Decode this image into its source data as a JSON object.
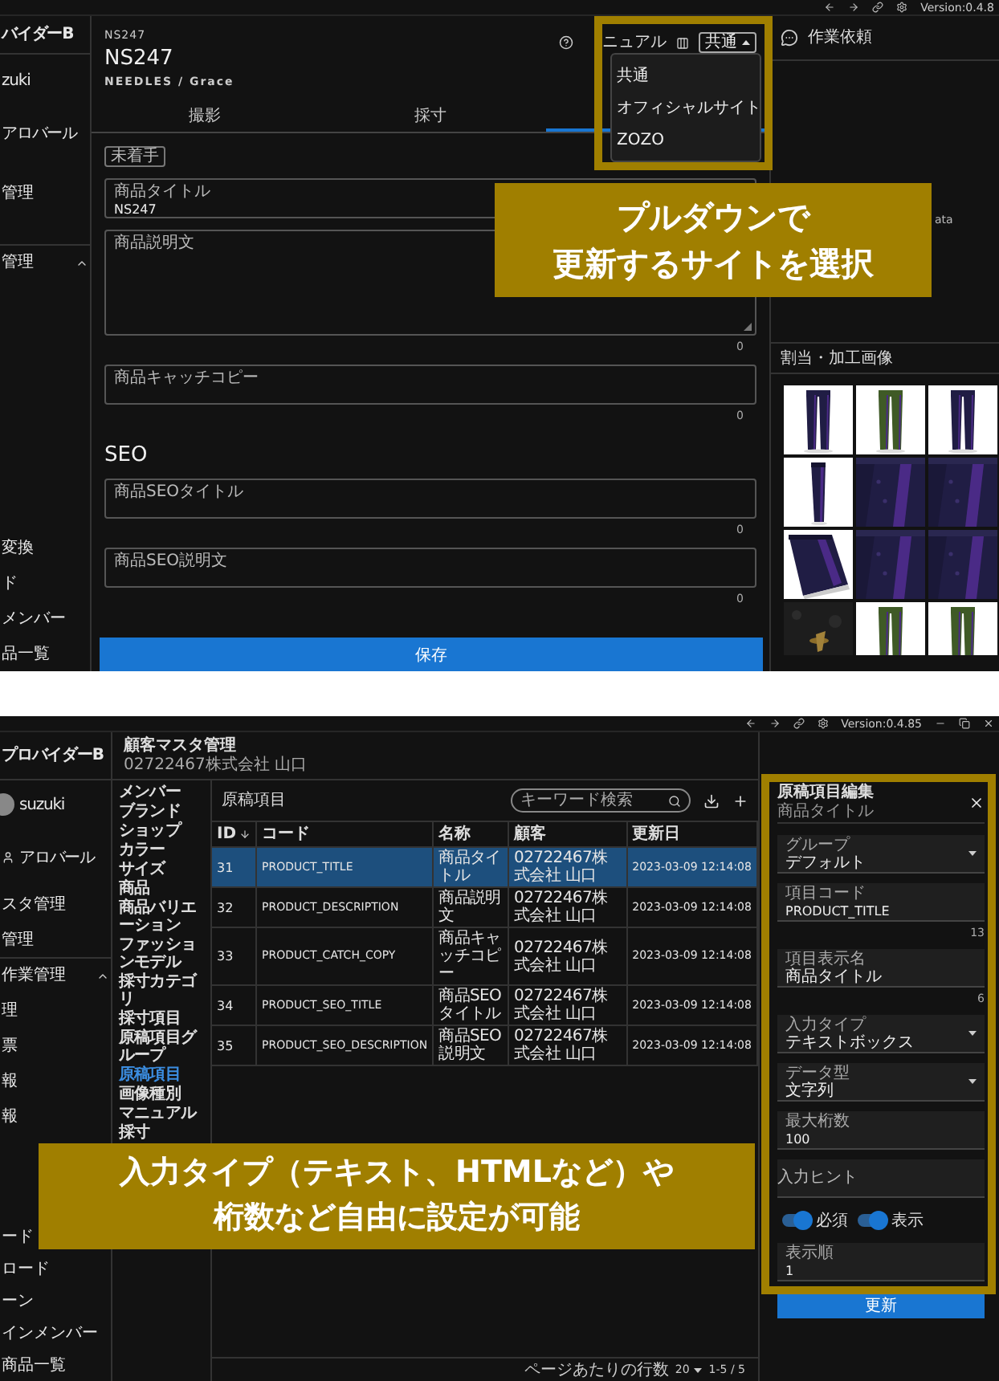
{
  "top_screen": {
    "toolbar": {
      "version": "Version:0.4.8"
    },
    "sidebar": {
      "header": "バイダーB",
      "user": "zuki",
      "role": "アロバール",
      "nav": [
        "管理"
      ],
      "group": {
        "label": "管理",
        "expanded": true,
        "bottom_items": [
          "変換",
          "ド",
          "メンバー",
          "品一覧"
        ]
      }
    },
    "product": {
      "code": "NS247",
      "title": "NS247",
      "brand": "NEEDLES / Grace"
    },
    "header_controls": {
      "manual": "ニュアル",
      "site_select": {
        "value": "共通",
        "expanded": true,
        "options": [
          "共通",
          "オフィシャルサイト",
          "ZOZO"
        ]
      }
    },
    "tabs": [
      {
        "label": "撮影",
        "selected": false
      },
      {
        "label": "採寸",
        "selected": false
      },
      {
        "selected": true
      }
    ],
    "form": {
      "status": "未着手",
      "fields": [
        {
          "kind": "input",
          "label": "商品タイトル",
          "value": "NS247"
        },
        {
          "kind": "textarea",
          "label": "商品説明文",
          "counter": "0"
        },
        {
          "kind": "input",
          "label": "商品キャッチコピー",
          "counter": "0"
        }
      ],
      "seo_heading": "SEO",
      "seo_fields": [
        {
          "kind": "input",
          "label": "商品SEOタイトル",
          "counter": "0"
        },
        {
          "kind": "input",
          "label": "商品SEO説明文",
          "counter": "0"
        }
      ],
      "save": "保存"
    },
    "work_panel": {
      "title": "作業依頼",
      "note": "ata"
    },
    "images": {
      "title": "割当・加工画像"
    },
    "caption": {
      "lines": [
        "プルダウンで",
        "更新するサイトを選択"
      ]
    }
  },
  "bottom_screen": {
    "toolbar": {
      "version": "Version:0.4.85"
    },
    "sidebar": {
      "header": "プロバイダーB",
      "user": "suzuki",
      "role": "アロバール",
      "nav": [
        "スタ管理",
        "管理"
      ],
      "group": {
        "label": "作業管理",
        "expanded": true,
        "items": [
          "理",
          "票",
          "報",
          "報"
        ],
        "bottom_items": [
          "ード",
          "ロード",
          "ーン",
          "インメンバー",
          "商品一覧"
        ]
      }
    },
    "master": {
      "title": "顧客マスタ管理",
      "customer": "02722467株式会社 山口"
    },
    "subnav": [
      {
        "label": "メンバー",
        "selected": false
      },
      {
        "label": "ブランド",
        "selected": false
      },
      {
        "label": "ショップ",
        "selected": false
      },
      {
        "label": "カラー",
        "selected": false
      },
      {
        "label": "サイズ",
        "selected": false
      },
      {
        "label": "商品",
        "selected": false
      },
      {
        "label": "商品バリエーション",
        "selected": false
      },
      {
        "label": "ファッションモデル",
        "selected": false
      },
      {
        "label": "採寸カテゴリ",
        "selected": false
      },
      {
        "label": "採寸項目",
        "selected": false
      },
      {
        "label": "原稿項目グループ",
        "selected": false
      },
      {
        "label": "原稿項目",
        "selected": true
      },
      {
        "label": "画像種別",
        "selected": false
      },
      {
        "label": "マニュアル",
        "selected": false
      },
      {
        "label": "採寸",
        "selected": false
      }
    ],
    "table": {
      "title": "原稿項目",
      "search_placeholder": "キーワード検索",
      "columns": [
        {
          "label": "ID",
          "kind": "id",
          "sorted": true
        },
        {
          "label": "コード",
          "kind": "code",
          "sorted": false
        },
        {
          "label": "名称",
          "kind": "text",
          "sorted": false
        },
        {
          "label": "顧客",
          "kind": "text",
          "sorted": false
        },
        {
          "label": "更新日",
          "kind": "date",
          "sorted": false
        }
      ],
      "rows": [
        {
          "selected": true,
          "cells": [
            "31",
            "PRODUCT_TITLE",
            "商品タイトル",
            "02722467株式会社 山口",
            "2023-03-09 12:14:08"
          ]
        },
        {
          "selected": false,
          "cells": [
            "32",
            "PRODUCT_DESCRIPTION",
            "商品説明文",
            "02722467株式会社 山口",
            "2023-03-09 12:14:08"
          ]
        },
        {
          "selected": false,
          "cells": [
            "33",
            "PRODUCT_CATCH_COPY",
            "商品キャッチコピー",
            "02722467株式会社 山口",
            "2023-03-09 12:14:08"
          ]
        },
        {
          "selected": false,
          "cells": [
            "34",
            "PRODUCT_SEO_TITLE",
            "商品SEOタイトル",
            "02722467株式会社 山口",
            "2023-03-09 12:14:08"
          ]
        },
        {
          "selected": false,
          "cells": [
            "35",
            "PRODUCT_SEO_DESCRIPTION",
            "商品SEO説明文",
            "02722467株式会社 山口",
            "2023-03-09 12:14:08"
          ]
        }
      ],
      "footer": {
        "rows_per_page_label": "ページあたりの行数",
        "rows_per_page": "20",
        "range": "1-5 / 5"
      }
    },
    "edit_panel": {
      "title": "原稿項目編集",
      "subtitle": "商品タイトル",
      "fields": [
        {
          "kind": "select",
          "label": "グループ",
          "value": "デフォルト"
        },
        {
          "kind": "text",
          "label": "項目コード",
          "value": "PRODUCT_TITLE",
          "counter": "13"
        },
        {
          "kind": "text",
          "label": "項目表示名",
          "value": "商品タイトル",
          "counter": "6"
        },
        {
          "kind": "select",
          "label": "入力タイプ",
          "value": "テキストボックス"
        },
        {
          "kind": "select",
          "label": "データ型",
          "value": "文字列"
        },
        {
          "kind": "text",
          "label": "最大桁数",
          "value": "100"
        },
        {
          "kind": "hint",
          "placeholder": "入力ヒント"
        }
      ],
      "toggles": [
        {
          "label": "必須",
          "on": true
        },
        {
          "label": "表示",
          "on": true
        }
      ],
      "order_field": {
        "label": "表示順",
        "value": "1"
      },
      "submit": "更新"
    },
    "caption": {
      "lines": [
        "入力タイプ（テキスト、HTMLなど）や",
        "桁数など自由に設定が可能"
      ]
    }
  }
}
